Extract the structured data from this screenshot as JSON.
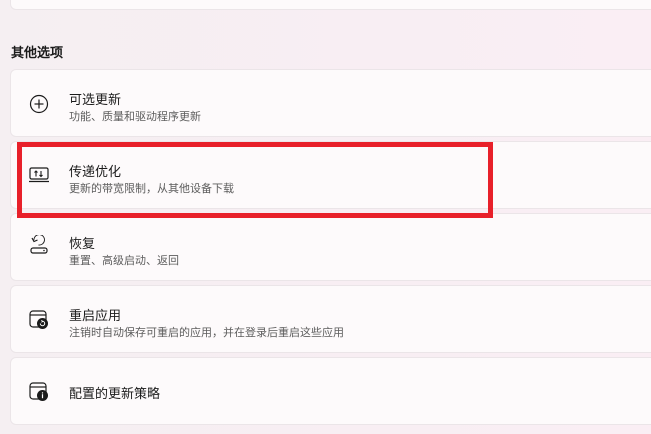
{
  "section": {
    "title": "其他选项"
  },
  "rows": [
    {
      "title": "可选更新",
      "subtitle": "功能、质量和驱动程序更新",
      "icon": "plus-circle-icon"
    },
    {
      "title": "传递优化",
      "subtitle": "更新的带宽限制，从其他设备下载",
      "icon": "delivery-optimization-icon"
    },
    {
      "title": "恢复",
      "subtitle": "重置、高级启动、返回",
      "icon": "recovery-icon"
    },
    {
      "title": "重启应用",
      "subtitle": "注销时自动保存可重启的应用，并在登录后重启这些应用",
      "icon": "restart-apps-icon"
    },
    {
      "title": "配置的更新策略",
      "subtitle": "",
      "icon": "update-policy-icon"
    }
  ],
  "colors": {
    "highlight": "#e8202a",
    "card_bg": "#fdfafb",
    "card_border": "#ebe5e8"
  }
}
